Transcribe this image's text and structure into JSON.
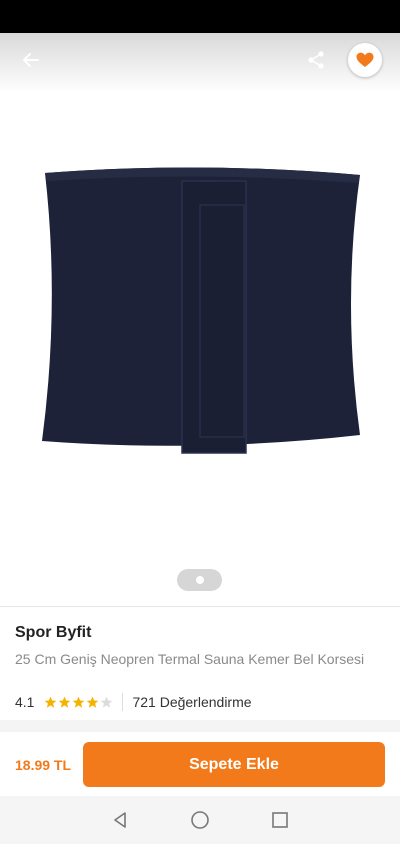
{
  "product": {
    "brand": "Spor Byfit",
    "title": "25 Cm Geniş Neopren Termal Sauna Kemer Bel Korsesi",
    "rating": "4.1",
    "stars_filled": 4,
    "stars_total": 5,
    "review_count": "721 Değerlendirme",
    "price": "18.99 TL",
    "image_color": "#1d2238"
  },
  "toolbar": {
    "back_icon": "arrow-left-icon",
    "share_icon": "share-icon",
    "favorite_icon": "heart-icon"
  },
  "actions": {
    "add_to_cart_label": "Sepete Ekle"
  },
  "gallery": {
    "current_page": 1,
    "total_pages": 1
  },
  "colors": {
    "accent": "#f27a1a",
    "star": "#f5b301"
  }
}
